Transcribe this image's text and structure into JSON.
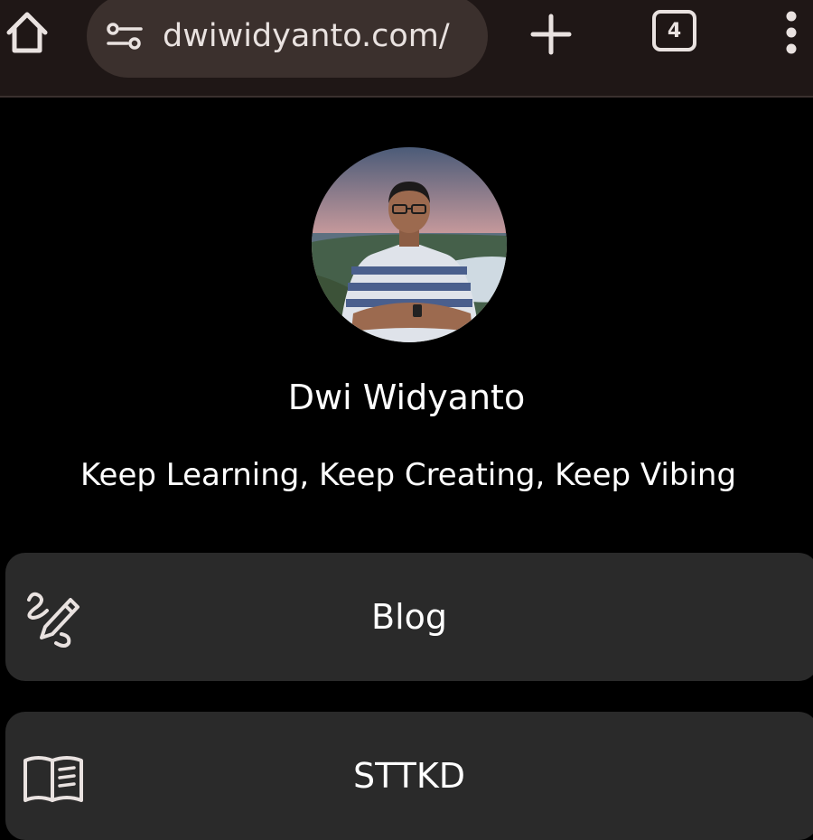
{
  "browser": {
    "url": "dwiwidyanto.com/",
    "tab_count": "4",
    "icons": {
      "home": "home-icon",
      "site_settings": "tune-icon",
      "new_tab": "plus-icon",
      "menu": "more-vert-icon"
    },
    "colors": {
      "toolbar_bg": "#1f1716",
      "url_pill_bg": "#3b302d",
      "toolbar_fg": "#e9e2e0"
    }
  },
  "profile": {
    "name": "Dwi Widyanto",
    "tagline": "Keep Learning, Keep Creating, Keep Vibing"
  },
  "links": [
    {
      "label": "Blog",
      "icon": "pencil-scribble-icon"
    },
    {
      "label": "STTKD",
      "icon": "open-book-icon"
    }
  ],
  "colors": {
    "page_bg": "#000000",
    "card_bg": "#2a2a2a",
    "text": "#ffffff"
  }
}
